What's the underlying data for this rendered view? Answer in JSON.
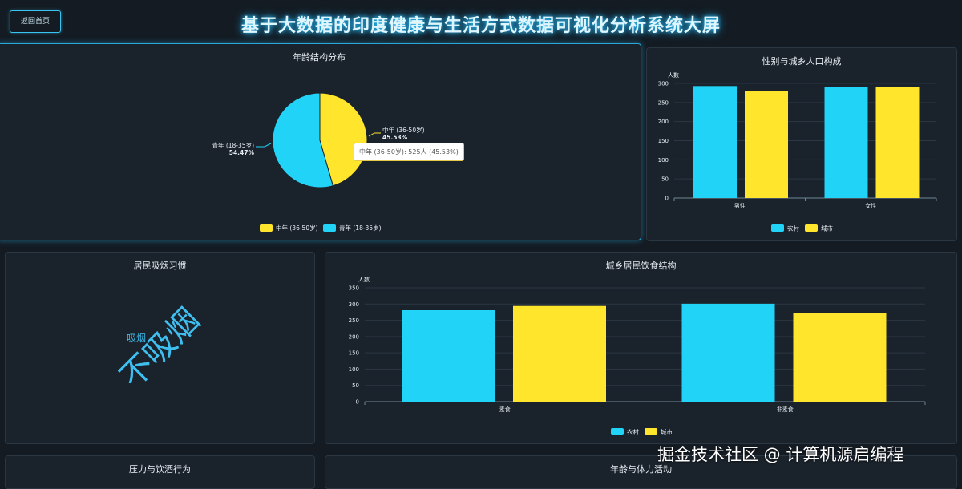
{
  "header": {
    "back_label": "返回首页",
    "title": "基于大数据的印度健康与生活方式数据可视化分析系统大屏"
  },
  "colors": {
    "cyan": "#22d3f8",
    "yellow": "#ffe52c",
    "bg": "#141b22",
    "panel": "#1a222b"
  },
  "panels": {
    "age": {
      "title": "年龄结构分布",
      "tooltip": "中年 (36-50岁): 525人 (45.53%)",
      "slices": [
        {
          "name": "中年 (36-50岁)",
          "pct": "45.53%"
        },
        {
          "name": "青年 (18-35岁)",
          "pct": "54.47%"
        }
      ],
      "legend": [
        "中年 (36-50岁)",
        "青年 (18-35岁)"
      ]
    },
    "gender": {
      "title": "性别与城乡人口构成"
    },
    "smoking": {
      "title": "居民吸烟习惯",
      "words": [
        {
          "text": "不吸烟"
        },
        {
          "text": "吸烟"
        }
      ]
    },
    "diet": {
      "title": "城乡居民饮食结构"
    },
    "stress": {
      "title": "压力与饮酒行为"
    },
    "activity": {
      "title": "年龄与体力活动"
    }
  },
  "chart_data": [
    {
      "type": "pie",
      "title": "年龄结构分布",
      "categories": [
        "中年 (36-50岁)",
        "青年 (18-35岁)"
      ],
      "values": [
        45.53,
        54.47
      ],
      "counts": [
        525,
        null
      ],
      "legend": "bottom"
    },
    {
      "type": "bar",
      "title": "性别与城乡人口构成",
      "ylabel": "人数",
      "categories": [
        "男性",
        "女性"
      ],
      "series": [
        {
          "name": "农村",
          "values": [
            293,
            291
          ]
        },
        {
          "name": "城市",
          "values": [
            279,
            290
          ]
        }
      ],
      "ylim": [
        0,
        300
      ],
      "yticks": [
        0,
        50,
        100,
        150,
        200,
        250,
        300
      ],
      "legend": "bottom"
    },
    {
      "type": "bar",
      "title": "城乡居民饮食结构",
      "ylabel": "人数",
      "categories": [
        "素食",
        "非素食"
      ],
      "series": [
        {
          "name": "农村",
          "values": [
            281,
            301
          ]
        },
        {
          "name": "城市",
          "values": [
            294,
            272
          ]
        }
      ],
      "ylim": [
        0,
        350
      ],
      "yticks": [
        0,
        50,
        100,
        150,
        200,
        250,
        300,
        350
      ],
      "legend": "bottom"
    }
  ],
  "watermark": "掘金技术社区 @ 计算机源启编程"
}
